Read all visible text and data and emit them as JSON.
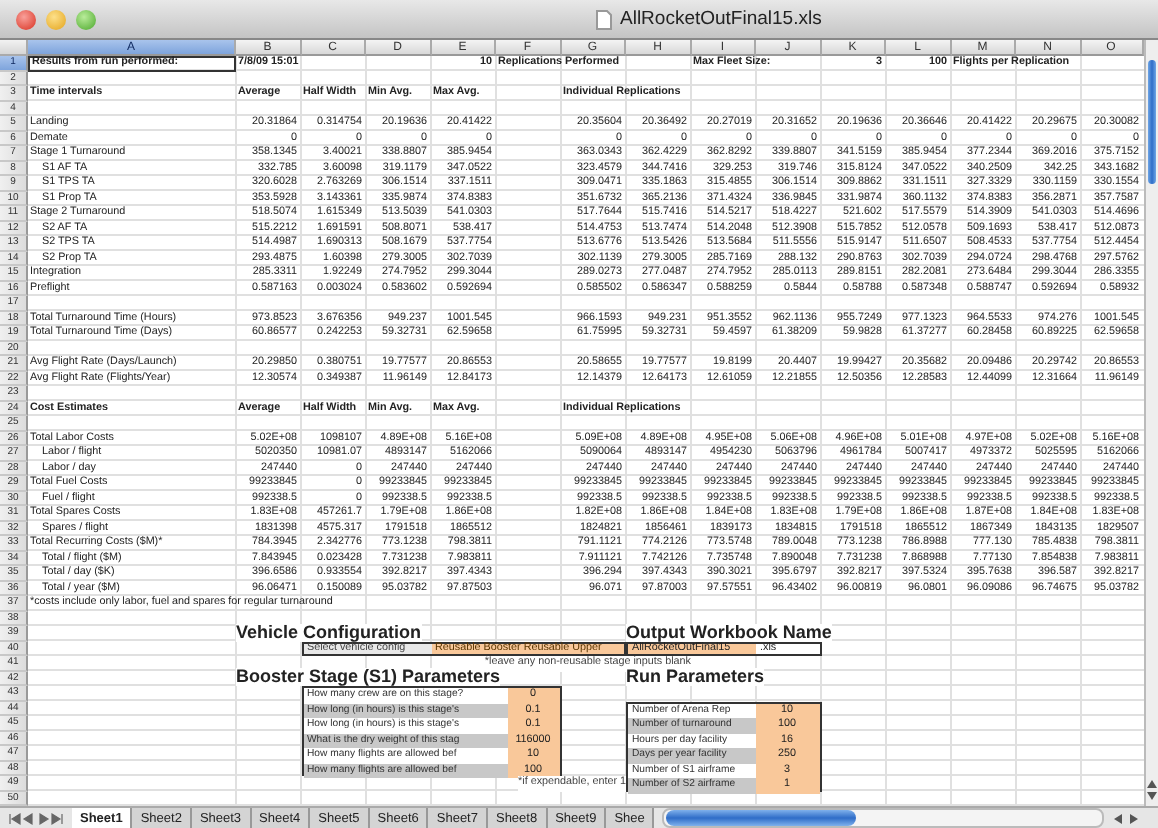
{
  "window": {
    "title": "AllRocketOutFinal15.xls"
  },
  "sheet": {
    "columns": [
      {
        "label": "A",
        "selected": true
      },
      {
        "label": "B",
        "selected": false
      },
      {
        "label": "C",
        "selected": false
      },
      {
        "label": "D",
        "selected": false
      },
      {
        "label": "E",
        "selected": false
      },
      {
        "label": "F",
        "selected": false
      },
      {
        "label": "G",
        "selected": false
      },
      {
        "label": "H",
        "selected": false
      },
      {
        "label": "I",
        "selected": false
      },
      {
        "label": "J",
        "selected": false
      },
      {
        "label": "K",
        "selected": false
      },
      {
        "label": "L",
        "selected": false
      },
      {
        "label": "M",
        "selected": false
      },
      {
        "label": "N",
        "selected": false
      },
      {
        "label": "O",
        "selected": false
      }
    ],
    "rows": [
      {
        "number": "1",
        "selected": true,
        "kind": "info",
        "cells": [
          "Results from run performed:",
          "7/8/09 15:01",
          null,
          null,
          "10",
          "Replications Performed",
          null,
          null,
          "Max Fleet Size:",
          null,
          "3",
          "100",
          "Flights per Replication"
        ]
      },
      {
        "number": "2",
        "selected": false
      },
      {
        "number": "3",
        "selected": false,
        "kind": "heading",
        "cells": [
          "Time intervals",
          "Average",
          "Half Width",
          "Min Avg.",
          "Max Avg.",
          null,
          "Individual Replications"
        ]
      },
      {
        "number": "4",
        "selected": false
      },
      {
        "number": "5",
        "selected": false,
        "kind": "data",
        "cells": [
          "Landing",
          "20.31864",
          "0.314754",
          "20.19636",
          "20.41422",
          null,
          "20.35604",
          "20.36492",
          "20.27019",
          "20.31652",
          "20.19636",
          "20.36646",
          "20.41422",
          "20.29675",
          "20.30082"
        ]
      },
      {
        "number": "6",
        "selected": false,
        "kind": "data",
        "cells": [
          "Demate",
          "0",
          "0",
          "0",
          "0",
          null,
          "0",
          "0",
          "0",
          "0",
          "0",
          "0",
          "0",
          "0",
          "0"
        ]
      },
      {
        "number": "7",
        "selected": false,
        "kind": "data",
        "cells": [
          "Stage 1 Turnaround",
          "358.1345",
          "3.40021",
          "338.8807",
          "385.9454",
          null,
          "363.0343",
          "362.4229",
          "362.8292",
          "339.8807",
          "341.5159",
          "385.9454",
          "377.2344",
          "369.2016",
          "375.7152"
        ]
      },
      {
        "number": "8",
        "selected": false,
        "kind": "sub",
        "cells": [
          "S1 AF TA",
          "332.785",
          "3.60098",
          "319.1179",
          "347.0522",
          null,
          "323.4579",
          "344.7416",
          "329.253",
          "319.746",
          "315.8124",
          "347.0522",
          "340.2509",
          "342.25",
          "343.1682"
        ]
      },
      {
        "number": "9",
        "selected": false,
        "kind": "sub",
        "cells": [
          "S1 TPS TA",
          "320.6028",
          "2.763269",
          "306.1514",
          "337.1511",
          null,
          "309.0471",
          "335.1863",
          "315.4855",
          "306.1514",
          "309.8862",
          "331.1511",
          "327.3329",
          "330.1159",
          "330.1554"
        ]
      },
      {
        "number": "10",
        "selected": false,
        "kind": "sub",
        "cells": [
          "S1 Prop TA",
          "353.5928",
          "3.143361",
          "335.9874",
          "374.8383",
          null,
          "351.6732",
          "365.2136",
          "371.4324",
          "336.9845",
          "331.9874",
          "360.1132",
          "374.8383",
          "356.2871",
          "357.7587"
        ]
      },
      {
        "number": "11",
        "selected": false,
        "kind": "data",
        "cells": [
          "Stage 2 Turnaround",
          "518.5074",
          "1.615349",
          "513.5039",
          "541.0303",
          null,
          "517.7644",
          "515.7416",
          "514.5217",
          "518.4227",
          "521.602",
          "517.5579",
          "514.3909",
          "541.0303",
          "514.4696"
        ]
      },
      {
        "number": "12",
        "selected": false,
        "kind": "sub",
        "cells": [
          "S2 AF TA",
          "515.2212",
          "1.691591",
          "508.8071",
          "538.417",
          null,
          "514.4753",
          "513.7474",
          "514.2048",
          "512.3908",
          "515.7852",
          "512.0578",
          "509.1693",
          "538.417",
          "512.0873"
        ]
      },
      {
        "number": "13",
        "selected": false,
        "kind": "sub",
        "cells": [
          "S2 TPS TA",
          "514.4987",
          "1.690313",
          "508.1679",
          "537.7754",
          null,
          "513.6776",
          "513.5426",
          "513.5684",
          "511.5556",
          "515.9147",
          "511.6507",
          "508.4533",
          "537.7754",
          "512.4454"
        ]
      },
      {
        "number": "14",
        "selected": false,
        "kind": "sub",
        "cells": [
          "S2 Prop TA",
          "293.4875",
          "1.60398",
          "279.3005",
          "302.7039",
          null,
          "302.1139",
          "279.3005",
          "285.7169",
          "288.132",
          "290.8763",
          "302.7039",
          "294.0724",
          "298.4768",
          "297.5762"
        ]
      },
      {
        "number": "15",
        "selected": false,
        "kind": "data",
        "cells": [
          "Integration",
          "285.3311",
          "1.92249",
          "274.7952",
          "299.3044",
          null,
          "289.0273",
          "277.0487",
          "274.7952",
          "285.0113",
          "289.8151",
          "282.2081",
          "273.6484",
          "299.3044",
          "286.3355"
        ]
      },
      {
        "number": "16",
        "selected": false,
        "kind": "data",
        "cells": [
          "Preflight",
          "0.587163",
          "0.003024",
          "0.583602",
          "0.592694",
          null,
          "0.585502",
          "0.586347",
          "0.588259",
          "0.5844",
          "0.58788",
          "0.587348",
          "0.588747",
          "0.592694",
          "0.58932"
        ]
      },
      {
        "number": "17",
        "selected": false
      },
      {
        "number": "18",
        "selected": false,
        "kind": "data",
        "cells": [
          "Total Turnaround Time (Hours)",
          "973.8523",
          "3.676356",
          "949.237",
          "1001.545",
          null,
          "966.1593",
          "949.231",
          "951.3552",
          "962.1136",
          "955.7249",
          "977.1323",
          "964.5533",
          "974.276",
          "1001.545"
        ]
      },
      {
        "number": "19",
        "selected": false,
        "kind": "data",
        "cells": [
          "Total Turnaround Time (Days)",
          "60.86577",
          "0.242253",
          "59.32731",
          "62.59658",
          null,
          "61.75995",
          "59.32731",
          "59.4597",
          "61.38209",
          "59.9828",
          "61.37277",
          "60.28458",
          "60.89225",
          "62.59658"
        ]
      },
      {
        "number": "20",
        "selected": false
      },
      {
        "number": "21",
        "selected": false,
        "kind": "data",
        "cells": [
          "Avg Flight Rate (Days/Launch)",
          "20.29850",
          "0.380751",
          "19.77577",
          "20.86553",
          null,
          "20.58655",
          "19.77577",
          "19.8199",
          "20.4407",
          "19.99427",
          "20.35682",
          "20.09486",
          "20.29742",
          "20.86553"
        ]
      },
      {
        "number": "22",
        "selected": false,
        "kind": "data",
        "cells": [
          "Avg Flight Rate (Flights/Year)",
          "12.30574",
          "0.349387",
          "11.96149",
          "12.84173",
          null,
          "12.14379",
          "12.64173",
          "12.61059",
          "12.21855",
          "12.50356",
          "12.28583",
          "12.44099",
          "12.31664",
          "11.96149"
        ]
      },
      {
        "number": "23",
        "selected": false
      },
      {
        "number": "24",
        "selected": false,
        "kind": "heading",
        "cells": [
          "Cost Estimates",
          "Average",
          "Half Width",
          "Min Avg.",
          "Max Avg.",
          null,
          "Individual Replications"
        ]
      },
      {
        "number": "25",
        "selected": false
      },
      {
        "number": "26",
        "selected": false,
        "kind": "data",
        "cells": [
          "Total Labor Costs",
          "5.02E+08",
          "1098107",
          "4.89E+08",
          "5.16E+08",
          null,
          "5.09E+08",
          "4.89E+08",
          "4.95E+08",
          "5.06E+08",
          "4.96E+08",
          "5.01E+08",
          "4.97E+08",
          "5.02E+08",
          "5.16E+08"
        ]
      },
      {
        "number": "27",
        "selected": false,
        "kind": "sub",
        "cells": [
          "Labor / flight",
          "5020350",
          "10981.07",
          "4893147",
          "5162066",
          null,
          "5090064",
          "4893147",
          "4954230",
          "5063796",
          "4961784",
          "5007417",
          "4973372",
          "5025595",
          "5162066"
        ]
      },
      {
        "number": "28",
        "selected": false,
        "kind": "sub",
        "cells": [
          "Labor / day",
          "247440",
          "0",
          "247440",
          "247440",
          null,
          "247440",
          "247440",
          "247440",
          "247440",
          "247440",
          "247440",
          "247440",
          "247440",
          "247440"
        ]
      },
      {
        "number": "29",
        "selected": false,
        "kind": "data",
        "cells": [
          "Total Fuel Costs",
          "99233845",
          "0",
          "99233845",
          "99233845",
          null,
          "99233845",
          "99233845",
          "99233845",
          "99233845",
          "99233845",
          "99233845",
          "99233845",
          "99233845",
          "99233845"
        ]
      },
      {
        "number": "30",
        "selected": false,
        "kind": "sub",
        "cells": [
          "Fuel / flight",
          "992338.5",
          "0",
          "992338.5",
          "992338.5",
          null,
          "992338.5",
          "992338.5",
          "992338.5",
          "992338.5",
          "992338.5",
          "992338.5",
          "992338.5",
          "992338.5",
          "992338.5"
        ]
      },
      {
        "number": "31",
        "selected": false,
        "kind": "data",
        "cells": [
          "Total Spares Costs",
          "1.83E+08",
          "457261.7",
          "1.79E+08",
          "1.86E+08",
          null,
          "1.82E+08",
          "1.86E+08",
          "1.84E+08",
          "1.83E+08",
          "1.79E+08",
          "1.86E+08",
          "1.87E+08",
          "1.84E+08",
          "1.83E+08"
        ]
      },
      {
        "number": "32",
        "selected": false,
        "kind": "sub",
        "cells": [
          "Spares / flight",
          "1831398",
          "4575.317",
          "1791518",
          "1865512",
          null,
          "1824821",
          "1856461",
          "1839173",
          "1834815",
          "1791518",
          "1865512",
          "1867349",
          "1843135",
          "1829507"
        ]
      },
      {
        "number": "33",
        "selected": false,
        "kind": "data",
        "cells": [
          "Total Recurring Costs ($M)*",
          "784.3945",
          "2.342776",
          "773.1238",
          "798.3811",
          null,
          "791.1121",
          "774.2126",
          "773.5748",
          "789.0048",
          "773.1238",
          "786.8988",
          "777.130",
          "785.4838",
          "798.3811"
        ]
      },
      {
        "number": "34",
        "selected": false,
        "kind": "sub",
        "cells": [
          "Total / flight ($M)",
          "7.843945",
          "0.023428",
          "7.731238",
          "7.983811",
          null,
          "7.911121",
          "7.742126",
          "7.735748",
          "7.890048",
          "7.731238",
          "7.868988",
          "7.77130",
          "7.854838",
          "7.983811"
        ]
      },
      {
        "number": "35",
        "selected": false,
        "kind": "sub",
        "cells": [
          "Total / day ($K)",
          "396.6586",
          "0.933554",
          "392.8217",
          "397.4343",
          null,
          "396.294",
          "397.4343",
          "390.3021",
          "395.6797",
          "392.8217",
          "397.5324",
          "395.7638",
          "396.587",
          "392.8217"
        ]
      },
      {
        "number": "36",
        "selected": false,
        "kind": "sub",
        "cells": [
          "Total / year ($M)",
          "96.06471",
          "0.150089",
          "95.03782",
          "97.87503",
          null,
          "96.071",
          "97.87003",
          "97.57551",
          "96.43402",
          "96.00819",
          "96.0801",
          "96.09086",
          "96.74675",
          "95.03782"
        ]
      },
      {
        "number": "37",
        "selected": false,
        "kind": "data",
        "cells": [
          "*costs include only labor, fuel and spares for regular turnaround"
        ]
      },
      {
        "number": "38",
        "selected": false
      },
      {
        "number": "39",
        "selected": false
      },
      {
        "number": "40",
        "selected": false
      },
      {
        "number": "41",
        "selected": false
      },
      {
        "number": "42",
        "selected": false
      },
      {
        "number": "43",
        "selected": false
      },
      {
        "number": "44",
        "selected": false
      },
      {
        "number": "45",
        "selected": false
      },
      {
        "number": "46",
        "selected": false
      },
      {
        "number": "47",
        "selected": false
      },
      {
        "number": "48",
        "selected": false
      },
      {
        "number": "49",
        "selected": false
      },
      {
        "number": "50",
        "selected": false
      }
    ]
  },
  "vehicle_configuration": {
    "title": "Vehicle Configuration",
    "prompt": "Select vehicle config",
    "value": "Reusable Booster Reusable Upper",
    "note": "*leave any non-reusable stage inputs blank"
  },
  "booster_stage": {
    "title": "Booster Stage (S1) Parameters",
    "note": "*if expendable, enter 1",
    "params": [
      {
        "question": "How many crew are on this stage?",
        "value": "0"
      },
      {
        "question": "How long (in hours) is this stage's",
        "value": "0.1"
      },
      {
        "question": "How long (in hours) is this stage's",
        "value": "0.1"
      },
      {
        "question": "What is the dry weight of this stag",
        "value": "116000"
      },
      {
        "question": "How many flights are allowed bef",
        "value": "10"
      },
      {
        "question": "How many flights are allowed bef",
        "value": "100"
      }
    ]
  },
  "output_workbook": {
    "title": "Output Workbook Name",
    "value": "AllRocketOutFinal15",
    "extension": ".xls"
  },
  "run_parameters": {
    "title": "Run Parameters",
    "params": [
      {
        "question": "Number of Arena Rep",
        "value": "10"
      },
      {
        "question": "Number of turnaround",
        "value": "100"
      },
      {
        "question": "Hours per day facility",
        "value": "16"
      },
      {
        "question": "Days per year facility",
        "value": "250"
      },
      {
        "question": "Number of S1 airframe",
        "value": "3"
      },
      {
        "question": "Number of S2 airframe",
        "value": "1"
      }
    ]
  },
  "sheet_tabs": [
    {
      "label": "Sheet1",
      "selected": true
    },
    {
      "label": "Sheet2",
      "selected": false
    },
    {
      "label": "Sheet3",
      "selected": false
    },
    {
      "label": "Sheet4",
      "selected": false
    },
    {
      "label": "Sheet5",
      "selected": false
    },
    {
      "label": "Sheet6",
      "selected": false
    },
    {
      "label": "Sheet7",
      "selected": false
    },
    {
      "label": "Sheet8",
      "selected": false
    },
    {
      "label": "Sheet9",
      "selected": false
    },
    {
      "label": "Shee",
      "selected": false
    }
  ]
}
